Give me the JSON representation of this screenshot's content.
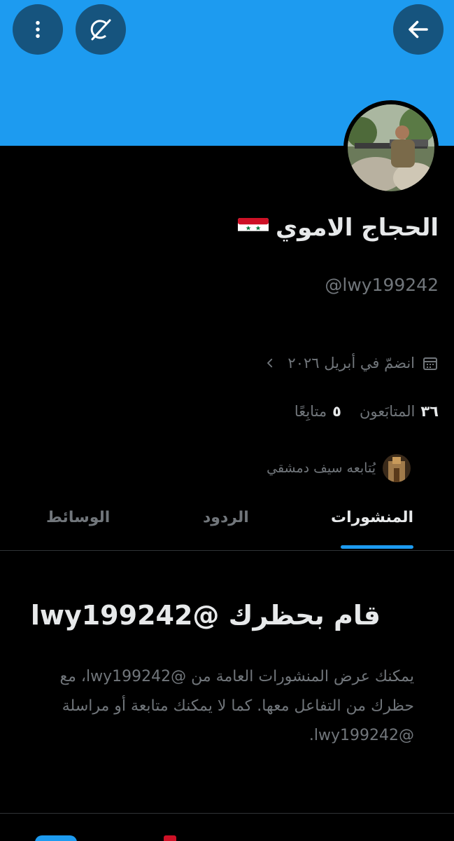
{
  "header": {
    "back_icon": "arrow-left-icon",
    "grok_icon": "grok-icon",
    "more_icon": "more-vertical-icon",
    "banner_color": "#1d9bf0"
  },
  "profile": {
    "display_name": "الحجاج الاموي",
    "flag": "syria-flag",
    "handle": "@lwy199242",
    "joined": "انضمّ في أبريل ٢٠٢٦",
    "following_count": "٥",
    "following_label": "متابِعًا",
    "followers_count": "٣٦",
    "followers_label": "المتابَعون",
    "followed_by": "يُتابعه سيف دمشقي"
  },
  "tabs": [
    {
      "label": "المنشورات",
      "active": true
    },
    {
      "label": "الردود",
      "active": false
    },
    {
      "label": "الوسائط",
      "active": false
    }
  ],
  "blocked": {
    "title": "قام بحظرك @lwy199242",
    "description": "يمكنك عرض المنشورات العامة من @lwy199242، مع حظرك من التفاعل معها. كما لا يمكنك متابعة أو مراسلة @lwy199242."
  },
  "colors": {
    "accent": "#1d9bf0",
    "background": "#000000",
    "secondary_text": "#71767b"
  }
}
